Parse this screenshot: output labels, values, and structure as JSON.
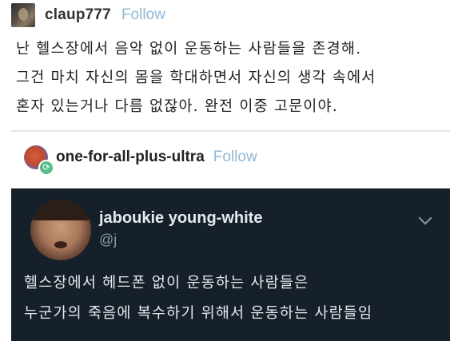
{
  "colors": {
    "follow_link": "#8fb7d6",
    "tweet_background": "#15202b",
    "reblog_badge": "#56bc8a"
  },
  "post": {
    "username": "claup777",
    "follow_label": "Follow",
    "avatar_icon": "user-photo-icon",
    "lines": [
      "난 헬스장에서 음악 없이 운동하는 사람들을 존경해.",
      "그건 마치 자신의 몸을 학대하면서 자신의 생각 속에서",
      "혼자 있는거나 다름 없잖아. 완전 이중 고문이야."
    ]
  },
  "reblog": {
    "username": "one-for-all-plus-ultra",
    "follow_label": "Follow",
    "avatar_icon": "user-avatar-icon",
    "badge_icon": "reblog-icon",
    "badge_glyph": "⟳"
  },
  "tweet": {
    "display_name": "jaboukie young-white",
    "handle": "@j",
    "avatar_icon": "user-photo-icon",
    "menu_icon": "chevron-down-icon",
    "lines": [
      "헬스장에서 헤드폰 없이 운동하는 사람들은",
      "누군가의 죽음에 복수하기 위해서 운동하는 사람들임"
    ]
  }
}
